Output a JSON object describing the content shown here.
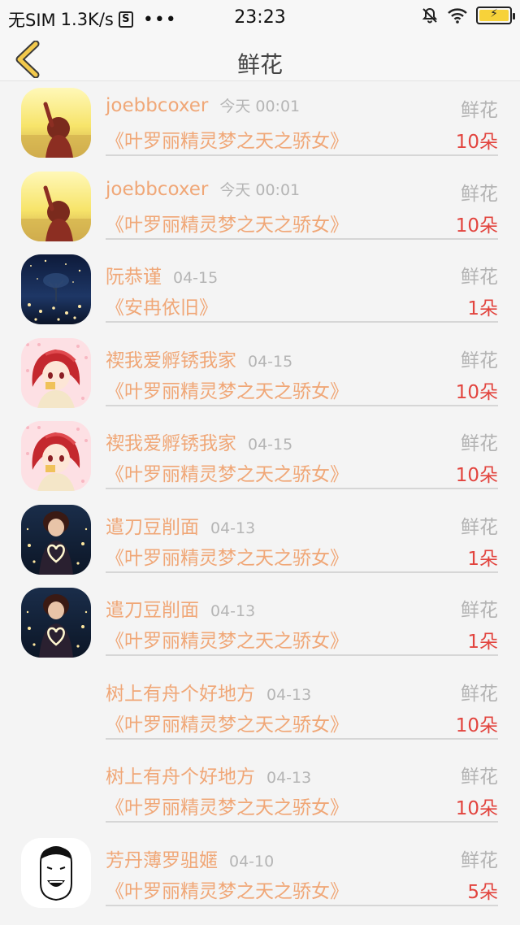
{
  "status_bar": {
    "carrier": "无SIM",
    "speed": "1.3K/s",
    "sim_badge": "S",
    "dots": "•••",
    "time": "23:23"
  },
  "header": {
    "title": "鲜花",
    "back_icon": "chevron-left-icon"
  },
  "colors": {
    "name": "#f0a777",
    "time": "#b5b5b5",
    "count": "#e2443e",
    "back_arrow": "#f2c94c"
  },
  "rows": [
    {
      "name": "joebbcoxer",
      "time": "今天 00:01",
      "type": "鲜花",
      "book": "《叶罗丽精灵梦之天之骄女》",
      "count": "10朵",
      "avatar": "sunset-girl"
    },
    {
      "name": "joebbcoxer",
      "time": "今天 00:01",
      "type": "鲜花",
      "book": "《叶罗丽精灵梦之天之骄女》",
      "count": "10朵",
      "avatar": "sunset-girl"
    },
    {
      "name": "阮恭谨",
      "time": "04-15",
      "type": "鲜花",
      "book": "《安冉依旧》",
      "count": "1朵",
      "avatar": "night-tree"
    },
    {
      "name": "禊我爱孵锈我家",
      "time": "04-15",
      "type": "鲜花",
      "book": "《叶罗丽精灵梦之天之骄女》",
      "count": "10朵",
      "avatar": "anime-red-hair"
    },
    {
      "name": "禊我爱孵锈我家",
      "time": "04-15",
      "type": "鲜花",
      "book": "《叶罗丽精灵梦之天之骄女》",
      "count": "10朵",
      "avatar": "anime-red-hair"
    },
    {
      "name": "遣刀豆削面",
      "time": "04-13",
      "type": "鲜花",
      "book": "《叶罗丽精灵梦之天之骄女》",
      "count": "1朵",
      "avatar": "heart-lights"
    },
    {
      "name": "遣刀豆削面",
      "time": "04-13",
      "type": "鲜花",
      "book": "《叶罗丽精灵梦之天之骄女》",
      "count": "1朵",
      "avatar": "heart-lights"
    },
    {
      "name": "树上有舟个好地方",
      "time": "04-13",
      "type": "鲜花",
      "book": "《叶罗丽精灵梦之天之骄女》",
      "count": "10朵",
      "avatar": "none"
    },
    {
      "name": "树上有舟个好地方",
      "time": "04-13",
      "type": "鲜花",
      "book": "《叶罗丽精灵梦之天之骄女》",
      "count": "10朵",
      "avatar": "none"
    },
    {
      "name": "芳丹薄罗驵嫟",
      "time": "04-10",
      "type": "鲜花",
      "book": "《叶罗丽精灵梦之天之骄女》",
      "count": "5朵",
      "avatar": "meme-face"
    }
  ]
}
